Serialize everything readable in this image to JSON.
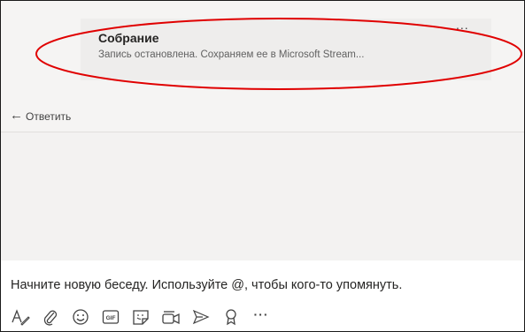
{
  "message": {
    "title": "Собрание",
    "subtitle": "Запись остановлена. Сохраняем ее в Microsoft Stream...",
    "more_label": "..."
  },
  "reply": {
    "label": "Ответить",
    "icon": "reply-arrow-icon"
  },
  "composer": {
    "placeholder": "Начните новую беседу. Используйте @, чтобы кого-то упомянуть.",
    "toolbar_icons": [
      "format-icon",
      "attach-icon",
      "emoji-icon",
      "gif-icon",
      "sticker-icon",
      "meet-now-icon",
      "send-icon",
      "praise-icon",
      "more-options-icon"
    ],
    "gif_label": "GIF",
    "more_label": "···"
  },
  "colors": {
    "annotation": "#e00000",
    "background": "#f3f2f1",
    "card": "#eeedec",
    "text": "#252423"
  }
}
